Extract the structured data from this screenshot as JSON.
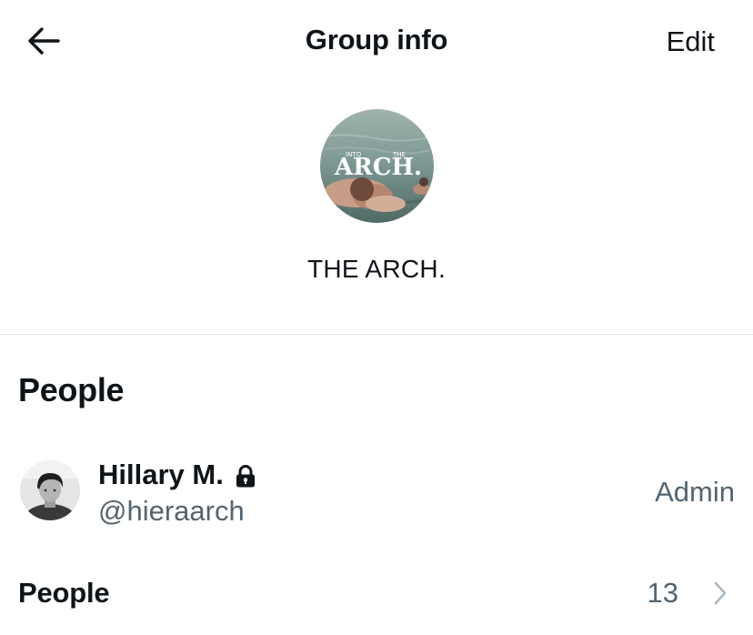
{
  "header": {
    "title": "Group info",
    "edit_label": "Edit"
  },
  "group": {
    "name": "THE ARCH.",
    "avatar_text_small_left": "INTO",
    "avatar_text_small_right": "THE",
    "avatar_text_large": "ARCH."
  },
  "people_section": {
    "title": "People",
    "members": [
      {
        "name": "Hillary M.",
        "handle": "@hieraarch",
        "role": "Admin",
        "protected": true
      }
    ]
  },
  "people_row": {
    "label": "People",
    "count": "13"
  },
  "colors": {
    "text_primary": "#0f1419",
    "text_secondary": "#536471",
    "divider": "#dfe3e7",
    "chevron": "#aab8c2"
  },
  "icons": {
    "back": "arrow-left-icon",
    "lock": "lock-icon",
    "chevron": "chevron-right-icon"
  }
}
